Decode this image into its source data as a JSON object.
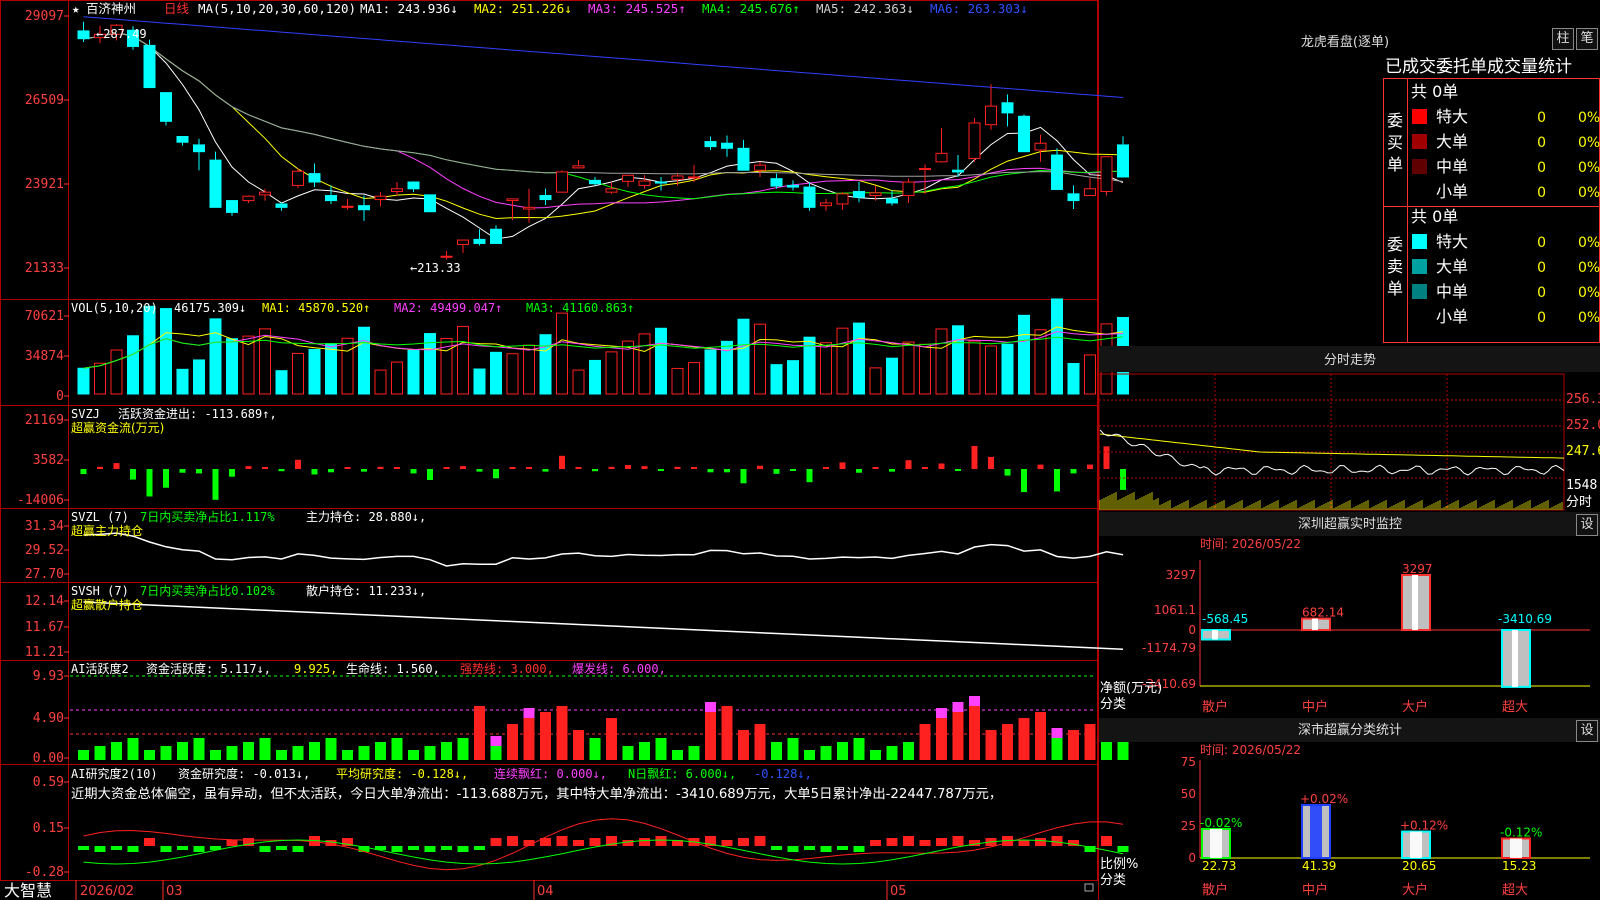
{
  "colors": {
    "up": "#ff2020",
    "down": "#00ffff",
    "ma1": "#ffffff",
    "ma2": "#ffff00",
    "ma3": "#ff40ff",
    "ma4": "#00ff00",
    "ma5": "#a0a0a0",
    "ma6": "#3040ff",
    "grid": "#b00000",
    "axis_text": "#ff4040"
  },
  "header": {
    "star": "★",
    "stock_name": "百济神州",
    "period": "日线",
    "ma_prefix": "MA(5,10,20,30,60,120)",
    "ma1": "MA1: 243.936↓",
    "ma2": "MA2: 251.226↓",
    "ma3": "MA3: 245.525↑",
    "ma4": "MA4: 245.676↑",
    "ma5": "MA5: 242.363↓",
    "ma6": "MA6: 263.303↓"
  },
  "panels": {
    "vol": {
      "prefix": "VOL(5,10,20)",
      "v": "46175.309↓",
      "ma1": "MA1: 45870.520↑",
      "ma2": "MA2: 49499.047↑",
      "ma3": "MA3: 41160.863↑"
    },
    "svzj": {
      "prefix": "SVZJ",
      "label": "活跃资金进出: -113.689↑,",
      "sub": "超赢资金流(万元)"
    },
    "svzl": {
      "prefix": "SVZL (7)",
      "ratio": "7日内买卖净占比1.117%",
      "hold": "主力持仓: 28.880↓,",
      "sub": "超赢主力持仓"
    },
    "svsh": {
      "prefix": "SVSH (7)",
      "ratio": "7日内买卖净占比0.102%",
      "hold": "散户持仓: 11.233↓,",
      "sub": "超赢散户持仓"
    },
    "ai_active": {
      "prefix": "AI活跃度2",
      "a": "资金活跃度: 5.117↓,",
      "b": "9.925,",
      "c": "生命线: 1.560,",
      "d": "强势线: 3.000,",
      "e": "爆发线: 6.000,"
    },
    "ai_research": {
      "prefix": "AI研究度2(10)",
      "a": "资金研究度: -0.013↓,",
      "b": "平均研究度: -0.128↓,",
      "c": "连续飘红: 0.000↓,",
      "d": "N日飘红: 6.000↓,",
      "e": "-0.128↓,",
      "commentary": "近期大资金总体偏空，虽有异动，但不太活跃，今日大单净流出：-113.688万元，其中特大单净流出：-3410.689万元，大单5日累计净出-22447.787万元，"
    }
  },
  "price_axis": [
    "29097",
    "26509",
    "23921",
    "21333"
  ],
  "vol_axis": [
    "70621",
    "34874",
    "0"
  ],
  "svzj_axis": [
    "21169",
    "3582",
    "-14006"
  ],
  "svzl_axis": [
    "31.34",
    "29.52",
    "27.70"
  ],
  "svsh_axis": [
    "12.14",
    "11.67",
    "11.21"
  ],
  "ai_axis": [
    "9.93",
    "4.90",
    "0.00"
  ],
  "research_axis": [
    "0.59",
    "0.15",
    "-0.28"
  ],
  "annotations": {
    "high": "287.49",
    "low": "213.33"
  },
  "date_axis": {
    "brand": "大智慧",
    "labels": [
      "2026/02",
      "03",
      "04",
      "05"
    ]
  },
  "chart_data": {
    "type": "candlestick",
    "series": [
      {
        "name": "K线",
        "ohlc": [
          [
            284.8,
            287.5,
            281.5,
            282.5
          ],
          [
            282.8,
            286.3,
            281.2,
            283.8
          ],
          [
            283.8,
            286.8,
            282.0,
            286.5
          ],
          [
            285.0,
            286.2,
            279.2,
            280.2
          ],
          [
            280.5,
            282.2,
            273.5,
            268.0
          ],
          [
            266.5,
            266.5,
            256.8,
            258.0
          ],
          [
            253.5,
            253.5,
            250.8,
            251.8
          ],
          [
            251.0,
            252.8,
            243.5,
            249.0
          ],
          [
            246.5,
            249.0,
            242.0,
            232.5
          ],
          [
            234.5,
            234.5,
            230.0,
            231.0
          ],
          [
            234.5,
            236.0,
            233.8,
            235.8
          ],
          [
            236.2,
            238.0,
            234.5,
            237.0
          ],
          [
            233.5,
            234.0,
            231.5,
            232.5
          ],
          [
            239.0,
            244.0,
            238.2,
            243.2
          ],
          [
            242.5,
            245.5,
            238.5,
            240.0
          ],
          [
            236.0,
            239.0,
            233.5,
            234.5
          ],
          [
            232.5,
            235.0,
            231.8,
            232.8
          ],
          [
            233.0,
            236.0,
            228.5,
            231.8
          ],
          [
            234.8,
            237.0,
            232.8,
            235.8
          ],
          [
            237.2,
            240.0,
            236.0,
            238.0
          ],
          [
            240.0,
            240.2,
            237.0,
            238.0
          ],
          [
            236.2,
            236.2,
            233.0,
            231.2
          ],
          [
            218.0,
            219.5,
            217.0,
            218.0
          ],
          [
            221.5,
            221.5,
            219.0,
            222.8
          ],
          [
            223.0,
            226.0,
            221.2,
            221.8
          ],
          [
            226.0,
            227.2,
            222.0,
            221.8
          ],
          [
            234.5,
            234.5,
            228.8,
            235.0
          ],
          [
            232.0,
            238.0,
            228.0,
            232.5
          ],
          [
            236.0,
            238.0,
            233.2,
            234.8
          ],
          [
            237.0,
            243.5,
            237.0,
            243.0
          ],
          [
            244.2,
            246.5,
            244.0,
            244.8
          ],
          [
            240.5,
            241.5,
            239.0,
            239.5
          ],
          [
            237.0,
            240.0,
            236.5,
            238.0
          ],
          [
            240.2,
            242.0,
            238.5,
            242.0
          ],
          [
            239.0,
            242.0,
            238.0,
            240.3
          ],
          [
            240.0,
            241.5,
            237.5,
            239.8
          ],
          [
            240.8,
            242.5,
            239.0,
            241.8
          ],
          [
            241.5,
            245.0,
            240.0,
            241.5
          ],
          [
            252.0,
            253.5,
            249.5,
            250.5
          ],
          [
            251.5,
            253.8,
            247.5,
            250.0
          ],
          [
            250.0,
            252.5,
            244.8,
            243.5
          ],
          [
            243.5,
            246.0,
            241.5,
            245.0
          ],
          [
            241.0,
            242.5,
            238.0,
            238.8
          ],
          [
            239.0,
            240.5,
            237.5,
            238.5
          ],
          [
            238.5,
            240.0,
            231.5,
            232.5
          ],
          [
            233.0,
            235.0,
            231.5,
            233.8
          ],
          [
            233.5,
            237.0,
            231.8,
            236.5
          ],
          [
            237.2,
            240.0,
            234.0,
            235.5
          ],
          [
            236.0,
            239.0,
            234.5,
            236.8
          ],
          [
            235.0,
            237.5,
            233.0,
            233.8
          ],
          [
            236.0,
            241.0,
            233.8,
            240.0
          ],
          [
            244.0,
            245.2,
            236.5,
            244.0
          ],
          [
            246.0,
            256.0,
            245.8,
            248.5
          ],
          [
            243.5,
            248.0,
            241.5,
            243.0
          ],
          [
            247.0,
            259.0,
            246.0,
            257.5
          ],
          [
            257.0,
            269.0,
            255.5,
            262.5
          ],
          [
            263.5,
            266.0,
            256.5,
            260.5
          ],
          [
            259.5,
            260.0,
            255.0,
            249.0
          ],
          [
            249.5,
            254.0,
            246.0,
            251.5
          ],
          [
            248.0,
            250.0,
            238.5,
            237.8
          ],
          [
            236.5,
            239.0,
            232.0,
            234.5
          ],
          [
            236.0,
            241.2,
            236.5,
            238.0
          ],
          [
            237.2,
            246.5,
            236.0,
            247.5
          ],
          [
            251.0,
            253.5,
            242.0,
            241.5
          ]
        ]
      }
    ]
  },
  "right_panel": {
    "top_title": "龙虎看盘(逐单)",
    "btn_zhu": "柱",
    "btn_bi": "笔",
    "table_title": "已成交委托单成交量统计",
    "buy_label": "委买单",
    "sell_label": "委卖单",
    "total_buy": "共 0单",
    "total_sell": "共 0单",
    "buy_rows": [
      {
        "name": "特大",
        "vol": "0",
        "pct": "0%",
        "color": "#ff0000"
      },
      {
        "name": "大单",
        "vol": "0",
        "pct": "0%",
        "color": "#a00000"
      },
      {
        "name": "中单",
        "vol": "0",
        "pct": "0%",
        "color": "#600000"
      },
      {
        "name": "小单",
        "vol": "0",
        "pct": "0%",
        "color": ""
      }
    ],
    "sell_rows": [
      {
        "name": "特大",
        "vol": "0",
        "pct": "0%",
        "color": "#00ffff"
      },
      {
        "name": "大单",
        "vol": "0",
        "pct": "0%",
        "color": "#00a0a0"
      },
      {
        "name": "中单",
        "vol": "0",
        "pct": "0%",
        "color": "#008080"
      },
      {
        "name": "小单",
        "vol": "0",
        "pct": "0%",
        "color": ""
      }
    ],
    "intraday_title": "分时走势",
    "intraday_axis": [
      "256.3",
      "252.0",
      "247.6",
      "1548",
      "分时"
    ],
    "sz_monitor_title": "深圳超赢实时监控",
    "sz_monitor_set": "设",
    "sz_monitor_time": "时间: 2026/05/22",
    "sz_monitor_axis": [
      "3297",
      "1061.1",
      "0",
      "-1174.79",
      "-3410.69"
    ],
    "sz_monitor_ylabel": "净额(万元)",
    "sz_monitor_cat": "分类",
    "sz_monitor_bars": [
      {
        "cat": "散户",
        "value": -568.45,
        "label": "-568.45"
      },
      {
        "cat": "中户",
        "value": 682.14,
        "label": "682.14"
      },
      {
        "cat": "大户",
        "value": 3297,
        "label": "3297"
      },
      {
        "cat": "超大",
        "value": -3410.69,
        "label": "-3410.69"
      }
    ],
    "sz_stat_title": "深市超赢分类统计",
    "sz_stat_set": "设",
    "sz_stat_time": "时间: 2026/05/22",
    "sz_stat_axis": [
      "75",
      "50",
      "25",
      "0"
    ],
    "sz_stat_ylabel": "比例%",
    "sz_stat_cat": "分类",
    "sz_stat_bars": [
      {
        "cat": "散户",
        "value": 22.73,
        "delta": "-0.02%",
        "color": "#00ff00"
      },
      {
        "cat": "中户",
        "value": 41.39,
        "delta": "+0.02%",
        "color": "#2040ff"
      },
      {
        "cat": "大户",
        "value": 20.65,
        "delta": "+0.12%",
        "color": "#00ffff"
      },
      {
        "cat": "超大",
        "value": 15.23,
        "delta": "-0.12%",
        "color": "#ff2020"
      }
    ]
  }
}
